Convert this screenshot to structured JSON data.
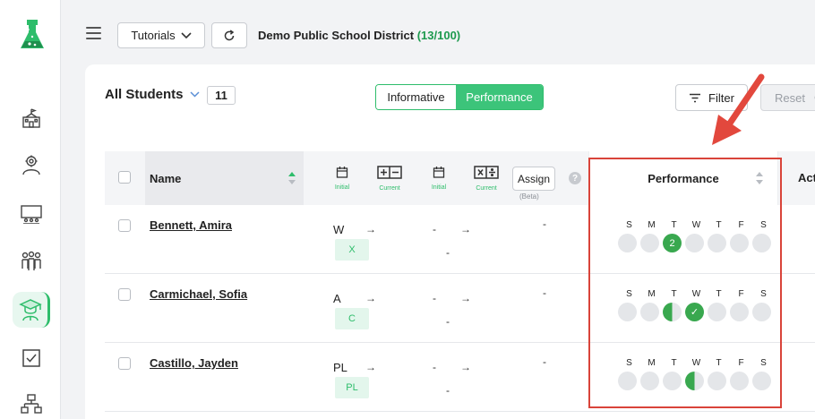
{
  "sidebar": {
    "items": [
      {
        "icon": "school-icon"
      },
      {
        "icon": "user-gear-icon"
      },
      {
        "icon": "presentation-icon"
      },
      {
        "icon": "group-icon"
      },
      {
        "icon": "graduate-icon",
        "active": true
      },
      {
        "icon": "checkbox-icon"
      },
      {
        "icon": "hierarchy-icon"
      }
    ],
    "colors": {
      "accent": "#2ebd6b"
    }
  },
  "topbar": {
    "tutorials_label": "Tutorials",
    "district_name": "Demo Public School District",
    "district_count": "(13/100)"
  },
  "header": {
    "title": "All Students",
    "student_count": "11",
    "view_tabs": [
      "Informative",
      "Performance"
    ],
    "active_tab": "Performance",
    "filter_label": "Filter",
    "reset_label": "Reset"
  },
  "table": {
    "columns": {
      "name": "Name",
      "initial_label_1": "Initial",
      "current_label_1": "Current",
      "initial_label_2": "Initial",
      "current_label_2": "Current",
      "assign_label": "Assign",
      "assign_sub": "(Beta)",
      "help": "?",
      "performance": "Performance",
      "actions": "Acti"
    },
    "day_letters": [
      "S",
      "M",
      "T",
      "W",
      "T",
      "F",
      "S"
    ],
    "rows": [
      {
        "name": "Bennett, Amira",
        "initial": "W",
        "current": "X",
        "math_initial": "-",
        "math_current": "-",
        "assign": "-",
        "days": [
          "empty",
          "empty",
          "full",
          "empty",
          "empty",
          "empty",
          "empty"
        ],
        "day_marks": [
          "",
          "",
          "2",
          "",
          "",
          "",
          ""
        ]
      },
      {
        "name": "Carmichael, Sofia",
        "initial": "A",
        "current": "C",
        "math_initial": "-",
        "math_current": "-",
        "assign": "-",
        "days": [
          "empty",
          "empty",
          "half",
          "full",
          "empty",
          "empty",
          "empty"
        ],
        "day_marks": [
          "",
          "",
          "",
          "✓",
          "",
          "",
          ""
        ]
      },
      {
        "name": "Castillo, Jayden",
        "initial": "PL",
        "current": "PL",
        "math_initial": "-",
        "math_current": "-",
        "assign": "-",
        "days": [
          "empty",
          "empty",
          "empty",
          "half",
          "empty",
          "empty",
          "empty"
        ],
        "day_marks": [
          "",
          "",
          "",
          "",
          "",
          "",
          ""
        ]
      }
    ]
  },
  "annotation": {
    "color": "#d9443a"
  }
}
